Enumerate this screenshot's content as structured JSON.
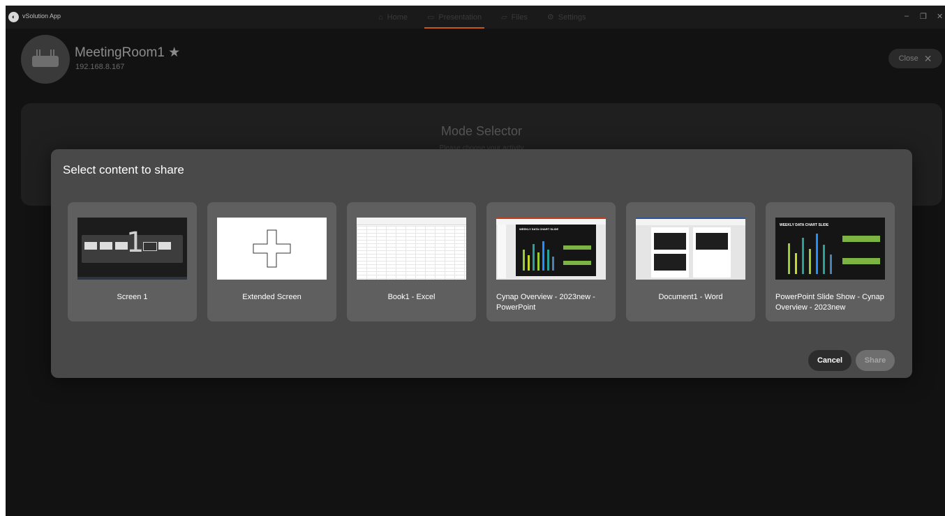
{
  "titlebar": {
    "app_title": "vSolution App",
    "nav": [
      {
        "label": "Home",
        "icon": "home-icon"
      },
      {
        "label": "Presentation",
        "icon": "presentation-icon"
      },
      {
        "label": "Files",
        "icon": "folder-icon"
      },
      {
        "label": "Settings",
        "icon": "gear-icon"
      }
    ],
    "minimize": "–",
    "maximize": "❐",
    "close": "✕"
  },
  "header": {
    "room_name": "MeetingRoom1 ★",
    "ip": "192.168.8.167",
    "close_label": "Close",
    "close_icon": "✕"
  },
  "mode_selector": {
    "title": "Mode Selector",
    "subtitle": "Please choose your activity"
  },
  "dialog": {
    "title": "Select content to share",
    "items": [
      {
        "label": "Screen 1",
        "thumb": "screen"
      },
      {
        "label": "Extended Screen",
        "thumb": "extended"
      },
      {
        "label": "Book1 - Excel",
        "thumb": "excel"
      },
      {
        "label": "Cynap Overview - 2023new - PowerPoint",
        "thumb": "powerpoint"
      },
      {
        "label": "Document1 - Word",
        "thumb": "word"
      },
      {
        "label": "PowerPoint Slide Show  - Cynap Overview - 2023new",
        "thumb": "slideshow"
      }
    ],
    "cancel_label": "Cancel",
    "share_label": "Share",
    "screen_number": "1",
    "plus_symbol": "+",
    "slide_title": "WEEKLY DATA CHART SLIDE"
  },
  "colors": {
    "accent": "#c65a10",
    "dialog_bg": "#494949",
    "card_bg": "#5f5f5f"
  }
}
